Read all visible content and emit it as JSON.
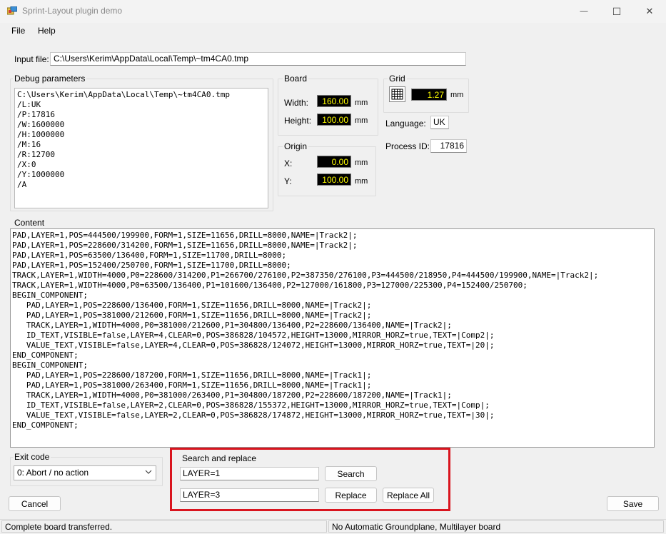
{
  "window": {
    "title": "Sprint-Layout plugin demo",
    "minimize_glyph": "—",
    "maximize_glyph": "☐",
    "close_glyph": "✕"
  },
  "menu": {
    "file": "File",
    "help": "Help"
  },
  "input_file": {
    "label": "Input file:",
    "value": "C:\\Users\\Kerim\\AppData\\Local\\Temp\\~tm4CA0.tmp"
  },
  "debug": {
    "title": "Debug parameters",
    "lines": "C:\\Users\\Kerim\\AppData\\Local\\Temp\\~tm4CA0.tmp\n/L:UK\n/P:17816\n/W:1600000\n/H:1000000\n/M:16\n/R:12700\n/X:0\n/Y:1000000\n/A"
  },
  "board": {
    "title": "Board",
    "width_label": "Width:",
    "width_value": "160.00",
    "height_label": "Height:",
    "height_value": "100.00",
    "unit": "mm"
  },
  "origin": {
    "title": "Origin",
    "x_label": "X:",
    "x_value": "0.00",
    "y_label": "Y:",
    "y_value": "100.00",
    "unit": "mm"
  },
  "grid": {
    "title": "Grid",
    "value": "1.27",
    "unit": "mm"
  },
  "language": {
    "label": "Language:",
    "value": "UK"
  },
  "process": {
    "label": "Process ID:",
    "value": "17816"
  },
  "content": {
    "title": "Content",
    "text": "PAD,LAYER=1,POS=444500/199900,FORM=1,SIZE=11656,DRILL=8000,NAME=|Track2|;\nPAD,LAYER=1,POS=228600/314200,FORM=1,SIZE=11656,DRILL=8000,NAME=|Track2|;\nPAD,LAYER=1,POS=63500/136400,FORM=1,SIZE=11700,DRILL=8000;\nPAD,LAYER=1,POS=152400/250700,FORM=1,SIZE=11700,DRILL=8000;\nTRACK,LAYER=1,WIDTH=4000,P0=228600/314200,P1=266700/276100,P2=387350/276100,P3=444500/218950,P4=444500/199900,NAME=|Track2|;\nTRACK,LAYER=1,WIDTH=4000,P0=63500/136400,P1=101600/136400,P2=127000/161800,P3=127000/225300,P4=152400/250700;\nBEGIN_COMPONENT;\n   PAD,LAYER=1,POS=228600/136400,FORM=1,SIZE=11656,DRILL=8000,NAME=|Track2|;\n   PAD,LAYER=1,POS=381000/212600,FORM=1,SIZE=11656,DRILL=8000,NAME=|Track2|;\n   TRACK,LAYER=1,WIDTH=4000,P0=381000/212600,P1=304800/136400,P2=228600/136400,NAME=|Track2|;\n   ID_TEXT,VISIBLE=false,LAYER=4,CLEAR=0,POS=386828/104572,HEIGHT=13000,MIRROR_HORZ=true,TEXT=|Comp2|;\n   VALUE_TEXT,VISIBLE=false,LAYER=4,CLEAR=0,POS=386828/124072,HEIGHT=13000,MIRROR_HORZ=true,TEXT=|20|;\nEND_COMPONENT;\nBEGIN_COMPONENT;\n   PAD,LAYER=1,POS=228600/187200,FORM=1,SIZE=11656,DRILL=8000,NAME=|Track1|;\n   PAD,LAYER=1,POS=381000/263400,FORM=1,SIZE=11656,DRILL=8000,NAME=|Track1|;\n   TRACK,LAYER=1,WIDTH=4000,P0=381000/263400,P1=304800/187200,P2=228600/187200,NAME=|Track1|;\n   ID_TEXT,VISIBLE=false,LAYER=2,CLEAR=0,POS=386828/155372,HEIGHT=13000,MIRROR_HORZ=true,TEXT=|Comp|;\n   VALUE_TEXT,VISIBLE=false,LAYER=2,CLEAR=0,POS=386828/174872,HEIGHT=13000,MIRROR_HORZ=true,TEXT=|30|;\nEND_COMPONENT;"
  },
  "exit_code": {
    "title": "Exit code",
    "selected": "0: Abort / no action"
  },
  "search_replace": {
    "title": "Search and replace",
    "search_value": "LAYER=1",
    "replace_value": "LAYER=3",
    "search_button": "Search",
    "replace_button": "Replace",
    "replace_all_button": "Replace All",
    "highlight_color": "#d9141e"
  },
  "buttons": {
    "cancel": "Cancel",
    "save": "Save"
  },
  "status": {
    "left": "Complete board transferred.",
    "right": "No Automatic Groundplane, Multilayer board"
  }
}
